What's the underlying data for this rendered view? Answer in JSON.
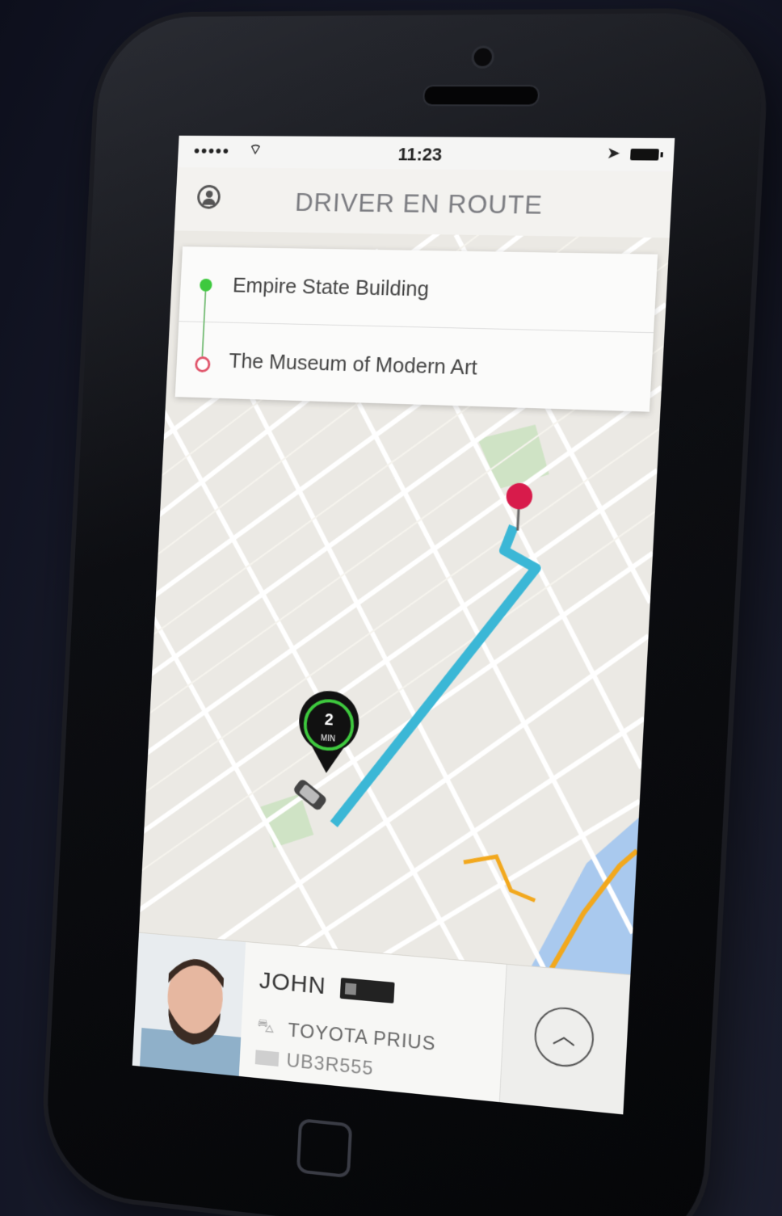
{
  "status_bar": {
    "signal": "●●●●●",
    "wifi": "⌔",
    "time": "11:23",
    "location_arrow": "➤"
  },
  "nav": {
    "title": "DRIVER EN ROUTE"
  },
  "route": {
    "pickup": "Empire State Building",
    "dropoff": "The Museum of Modern Art"
  },
  "eta": {
    "value": "2",
    "unit": "MIN"
  },
  "driver": {
    "name": "JOHN",
    "car_model": "TOYOTA PRIUS",
    "plate": "UB3R555"
  },
  "colors": {
    "route_line": "#3bb7d6",
    "pickup_dot": "#3ec93e",
    "destination_pin": "#d81b4b",
    "map_bg": "#ebe9e4",
    "park": "#cfe3c5",
    "water": "#a9c9ee",
    "highway": "#f2a81d"
  }
}
